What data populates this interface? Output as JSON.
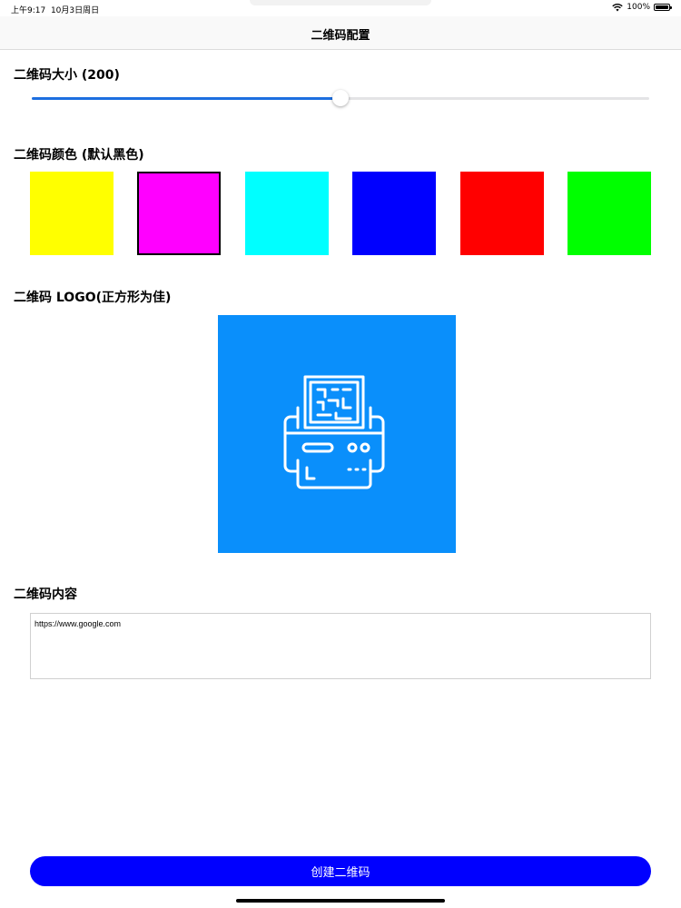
{
  "status_bar": {
    "time": "上午9:17",
    "date": "10月3日周日",
    "battery": "100%",
    "battery_level": 1.0
  },
  "nav": {
    "title": "二维码配置"
  },
  "size_section": {
    "label": "二维码大小 (200)",
    "slider_value_fraction": 0.5
  },
  "color_section": {
    "label": "二维码颜色 (默认黑色)",
    "swatches": [
      "#ffff00",
      "#ff00ff",
      "#00ffff",
      "#0000ff",
      "#ff0000",
      "#00ff00"
    ],
    "selected_index": 1
  },
  "logo_section": {
    "label": "二维码 LOGO(正方形为佳)",
    "logo_icon": "qr-printer-icon",
    "logo_background": "#0a8ffb"
  },
  "content_section": {
    "label": "二维码内容",
    "value": "https://www.google.com"
  },
  "create_button": {
    "label": "创建二维码",
    "color": "#0000ff"
  },
  "colors": {
    "accent": "#1d6fe0"
  }
}
